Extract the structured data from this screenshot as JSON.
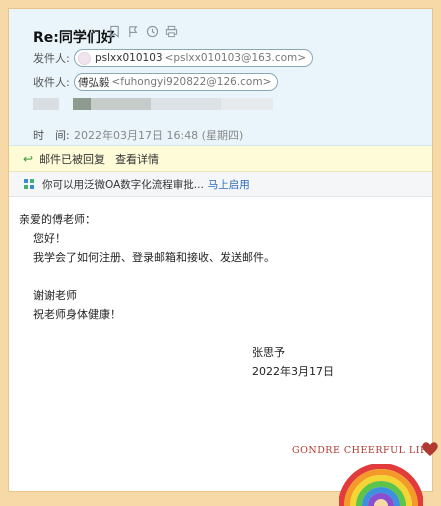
{
  "email": {
    "subject": "Re:同学们好",
    "from_label": "发件人:",
    "from_name": "pslxx010103",
    "from_address": "<pslxx010103@163.com>",
    "to_label": "收件人:",
    "to_name": "傅弘毅",
    "to_address": "<fuhongyi920822@126.com>",
    "time_label": "时　间:",
    "time_value": "2022年03月17日 16:48 (星期四)"
  },
  "icons": [
    "bookmark-icon",
    "flag-icon",
    "clock-icon",
    "print-icon"
  ],
  "banners": {
    "replied_text": "邮件已被回复",
    "replied_detail": "查看详情",
    "promo_text": "你可以用泛微OA数字化流程审批...",
    "promo_link": "马上启用"
  },
  "message": {
    "greeting": "亲爱的傅老师：",
    "line1": "您好！",
    "line2": "我学会了如何注册、登录邮箱和接收、发送邮件。",
    "line3": "谢谢老师",
    "line4": "祝老师身体健康！",
    "signature_name": "张思予",
    "signature_date": "2022年3月17日"
  },
  "stationery": {
    "brand": "GONDRE CHEERFUL LIFE",
    "accent": "#b03a32"
  }
}
